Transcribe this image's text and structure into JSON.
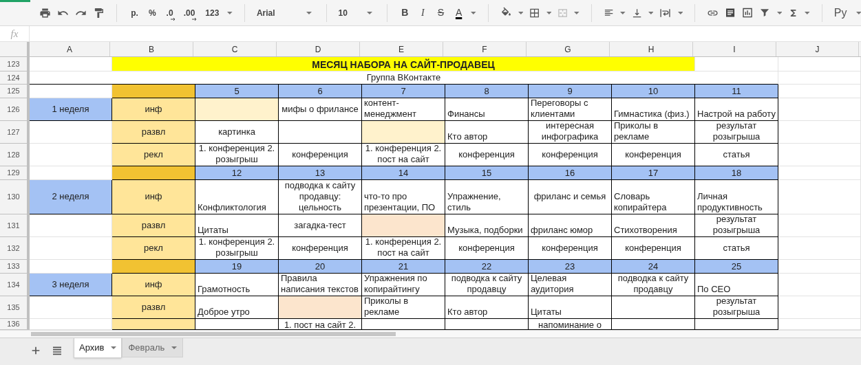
{
  "toolbar": {
    "number_formats": [
      "р.",
      "%",
      ".0",
      ".00",
      "123"
    ],
    "font": "Arial",
    "font_size": "10",
    "text_styles": [
      "B",
      "I",
      "S",
      "A"
    ],
    "input_tools": "Ру"
  },
  "formula_bar": {
    "label": "fx"
  },
  "column_headers": [
    "A",
    "B",
    "C",
    "D",
    "E",
    "F",
    "G",
    "H",
    "I",
    "J"
  ],
  "rows": [
    {
      "number": "123",
      "kind": "title",
      "cells": [
        {},
        {
          "text": "МЕСЯЦ НАБОРА НА САЙТ-ПРОДАВЕЦ",
          "color": "#ffff00",
          "kind": "center"
        },
        {}
      ]
    },
    {
      "number": "124",
      "kind": "subtitle",
      "cells": [
        {
          "text": "Группа ВКонтакте",
          "kind": "center"
        }
      ]
    },
    {
      "number": "125",
      "kind": "grid",
      "cells": [
        {},
        {
          "color": "#f1c232"
        },
        {
          "text": "5",
          "color": "#a4c2f4",
          "kind": "center"
        },
        {
          "text": "6",
          "color": "#a4c2f4",
          "kind": "center"
        },
        {
          "text": "7",
          "color": "#a4c2f4",
          "kind": "center"
        },
        {
          "text": "8",
          "color": "#a4c2f4",
          "kind": "center"
        },
        {
          "text": "9",
          "color": "#a4c2f4",
          "kind": "center"
        },
        {
          "text": "10",
          "color": "#a4c2f4",
          "kind": "center"
        },
        {
          "text": "11",
          "color": "#a4c2f4",
          "kind": "center"
        }
      ]
    },
    {
      "number": "126",
      "kind": "grid",
      "cells": [
        {
          "text": "1 неделя",
          "color": "#a4c2f4",
          "kind": "middle"
        },
        {
          "text": "инф",
          "color": "#ffe599",
          "kind": "middle"
        },
        {
          "color": "#fff2cc"
        },
        {
          "text": "мифы о фрилансе",
          "kind": "middle"
        },
        {
          "text": "контент-менеджмент",
          "kind": "left"
        },
        {
          "text": "Финансы",
          "kind": "left"
        },
        {
          "text": "Переговоры с клиентами",
          "kind": "left"
        },
        {
          "text": "Гимнастика (физ.)",
          "kind": "left"
        },
        {
          "text": "Настрой на работу",
          "kind": "left"
        }
      ]
    },
    {
      "number": "127",
      "kind": "grid",
      "cells": [
        {},
        {
          "text": "развл",
          "color": "#ffe599",
          "kind": "middle"
        },
        {
          "text": "картинка",
          "kind": "middle"
        },
        {},
        {
          "color": "#fff2cc"
        },
        {
          "text": "Кто автор",
          "kind": "left"
        },
        {
          "text": "интересная инфографика",
          "kind": "center"
        },
        {
          "text": "Приколы в рекламе",
          "kind": "left"
        },
        {
          "text": "результат розыгрыша",
          "kind": "center"
        }
      ]
    },
    {
      "number": "128",
      "kind": "grid",
      "cells": [
        {},
        {
          "text": "рекл",
          "color": "#ffe599",
          "kind": "middle"
        },
        {
          "text": "1. конференция 2. розыгрыш",
          "kind": "center"
        },
        {
          "text": "конференция",
          "kind": "middle"
        },
        {
          "text": "1. конференция 2. пост на сайт",
          "kind": "center"
        },
        {
          "text": "конференция",
          "kind": "middle"
        },
        {
          "text": "конференция",
          "kind": "middle"
        },
        {
          "text": "конференция",
          "kind": "middle"
        },
        {
          "text": "статья",
          "kind": "middle"
        }
      ]
    },
    {
      "number": "129",
      "kind": "grid",
      "cells": [
        {},
        {
          "color": "#f1c232"
        },
        {
          "text": "12",
          "color": "#a4c2f4",
          "kind": "center"
        },
        {
          "text": "13",
          "color": "#a4c2f4",
          "kind": "center"
        },
        {
          "text": "14",
          "color": "#a4c2f4",
          "kind": "center"
        },
        {
          "text": "15",
          "color": "#a4c2f4",
          "kind": "center"
        },
        {
          "text": "16",
          "color": "#a4c2f4",
          "kind": "center"
        },
        {
          "text": "17",
          "color": "#a4c2f4",
          "kind": "center"
        },
        {
          "text": "18",
          "color": "#a4c2f4",
          "kind": "center"
        }
      ]
    },
    {
      "number": "130",
      "kind": "grid",
      "cells": [
        {
          "text": "2 неделя",
          "color": "#a4c2f4",
          "kind": "middle"
        },
        {
          "text": "инф",
          "color": "#ffe599",
          "kind": "middle"
        },
        {
          "text": "Конфликтология",
          "kind": "left"
        },
        {
          "text": "подводка к сайту продавцу: цельность",
          "kind": "center"
        },
        {
          "text": "что-то про презентации, ПО",
          "kind": "left"
        },
        {
          "text": "Упражнение, стиль",
          "kind": "left"
        },
        {
          "text": "фриланс и семья",
          "kind": "middle"
        },
        {
          "text": "Словарь копирайтера",
          "kind": "left"
        },
        {
          "text": "Личная продуктивность",
          "kind": "left"
        }
      ]
    },
    {
      "number": "131",
      "kind": "grid",
      "cells": [
        {},
        {
          "text": "развл",
          "color": "#ffe599",
          "kind": "middle"
        },
        {
          "text": "Цитаты",
          "kind": "left"
        },
        {
          "text": "загадка-тест",
          "kind": "middle"
        },
        {
          "color": "#fce5cd"
        },
        {
          "text": "Музыка, подборки",
          "kind": "left"
        },
        {
          "text": "фриланс юмор",
          "kind": "left"
        },
        {
          "text": "Стихотворения",
          "kind": "left"
        },
        {
          "text": "результат розыгрыша",
          "kind": "center"
        }
      ]
    },
    {
      "number": "132",
      "kind": "grid",
      "cells": [
        {},
        {
          "text": "рекл",
          "color": "#ffe599",
          "kind": "middle"
        },
        {
          "text": "1. конференция 2. розыгрыш",
          "kind": "center"
        },
        {
          "text": "конференция",
          "kind": "middle"
        },
        {
          "text": "1. конференция 2. пост на сайт",
          "kind": "center"
        },
        {
          "text": "конференция",
          "kind": "middle"
        },
        {
          "text": "конференция",
          "kind": "middle"
        },
        {
          "text": "конференция",
          "kind": "middle"
        },
        {
          "text": "статья",
          "kind": "middle"
        }
      ]
    },
    {
      "number": "133",
      "kind": "grid",
      "cells": [
        {},
        {
          "color": "#f1c232"
        },
        {
          "text": "19",
          "color": "#a4c2f4",
          "kind": "center"
        },
        {
          "text": "20",
          "color": "#a4c2f4",
          "kind": "center"
        },
        {
          "text": "21",
          "color": "#a4c2f4",
          "kind": "center"
        },
        {
          "text": "22",
          "color": "#a4c2f4",
          "kind": "center"
        },
        {
          "text": "23",
          "color": "#a4c2f4",
          "kind": "center"
        },
        {
          "text": "24",
          "color": "#a4c2f4",
          "kind": "center"
        },
        {
          "text": "25",
          "color": "#a4c2f4",
          "kind": "center"
        }
      ]
    },
    {
      "number": "134",
      "kind": "grid",
      "cells": [
        {
          "text": "3 неделя",
          "color": "#a4c2f4",
          "kind": "middle"
        },
        {
          "text": "инф",
          "color": "#ffe599",
          "kind": "middle"
        },
        {
          "text": "Грамотность",
          "kind": "left"
        },
        {
          "text": "Правила написания текстов",
          "kind": "left"
        },
        {
          "text": "Упражнения по копирайтингу",
          "kind": "left"
        },
        {
          "text": "подводка к сайту продавцу",
          "kind": "center"
        },
        {
          "text": "Целевая аудитория",
          "kind": "left"
        },
        {
          "text": "подводка к сайту продавцу",
          "kind": "center"
        },
        {
          "text": "По СЕО",
          "kind": "left"
        }
      ]
    },
    {
      "number": "135",
      "kind": "grid",
      "cells": [
        {},
        {
          "text": "развл",
          "color": "#ffe599",
          "kind": "middle"
        },
        {
          "text": "Доброе утро",
          "kind": "left"
        },
        {
          "color": "#fce5cd"
        },
        {
          "text": "Приколы в рекламе",
          "kind": "left"
        },
        {
          "text": "Кто автор",
          "kind": "left"
        },
        {
          "text": "Цитаты",
          "kind": "left"
        },
        {},
        {
          "text": "результат розыгрыша",
          "kind": "center"
        }
      ]
    },
    {
      "number": "136",
      "kind": "partial",
      "cells": [
        {},
        {
          "color": "#ffe599"
        },
        {},
        {
          "text": "1. пост на сайт 2.",
          "kind": "top"
        },
        {},
        {},
        {
          "text": "напоминание о",
          "kind": "top"
        },
        {},
        {}
      ]
    }
  ],
  "sheet_tabs": [
    {
      "label": "Архив",
      "selected": true
    },
    {
      "label": "Февраль",
      "selected": false
    }
  ]
}
